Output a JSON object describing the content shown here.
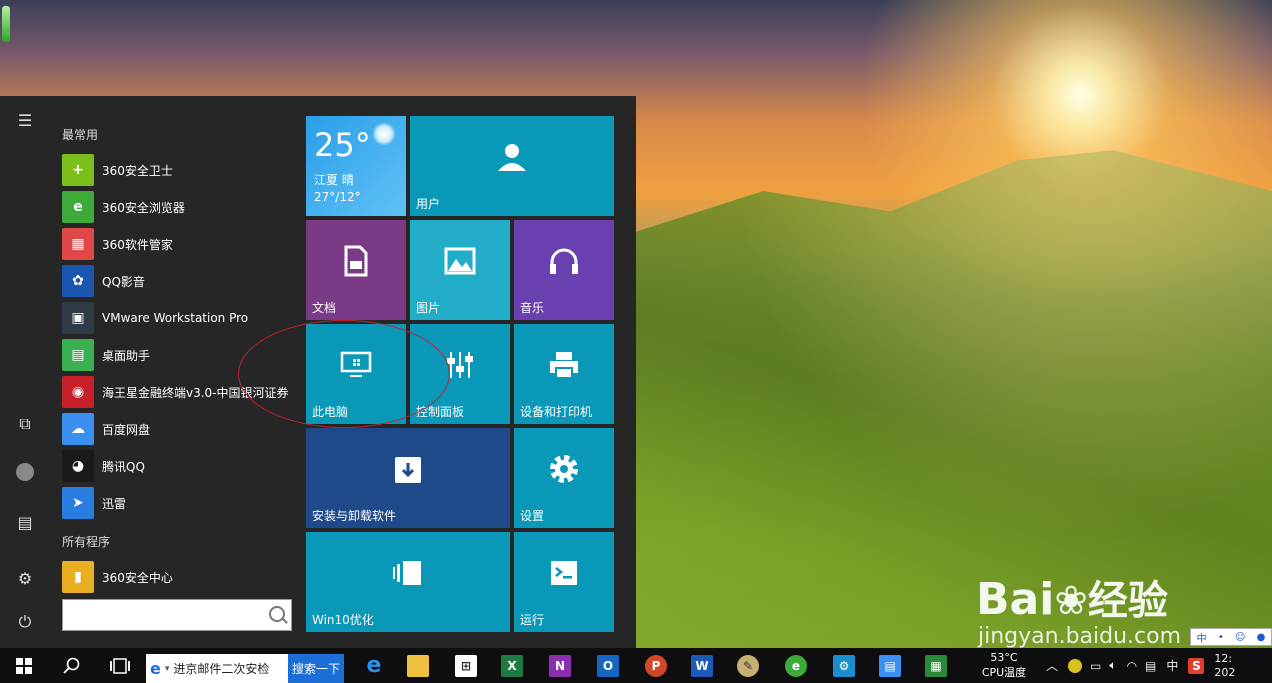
{
  "start_menu": {
    "most_used_label": "最常用",
    "all_programs_label": "所有程序",
    "apps": [
      {
        "label": "360安全卫士",
        "icon": "360-safe-icon",
        "color": "#7cbf1c",
        "glyph": "+"
      },
      {
        "label": "360安全浏览器",
        "icon": "360-browser-icon",
        "color": "#3eaa3a",
        "glyph": "e"
      },
      {
        "label": "360软件管家",
        "icon": "360-software-manager-icon",
        "color": "#e04848",
        "glyph": "▦"
      },
      {
        "label": "QQ影音",
        "icon": "qq-player-icon",
        "color": "#1a56b0",
        "glyph": "✿"
      },
      {
        "label": "VMware Workstation Pro",
        "icon": "vmware-icon",
        "color": "#2f3a44",
        "glyph": "▣"
      },
      {
        "label": "桌面助手",
        "icon": "desktop-assistant-icon",
        "color": "#3ab050",
        "glyph": "▤"
      },
      {
        "label": "海王星金融终端v3.0-中国银河证券",
        "icon": "neptune-finance-icon",
        "color": "#c8202a",
        "glyph": "◉"
      },
      {
        "label": "百度网盘",
        "icon": "baidu-netdisk-icon",
        "color": "#3a8ff0",
        "glyph": "☁"
      },
      {
        "label": "腾讯QQ",
        "icon": "tencent-qq-icon",
        "color": "#1a1a1a",
        "glyph": "◕"
      },
      {
        "label": "迅雷",
        "icon": "xunlei-icon",
        "color": "#2a7de0",
        "glyph": "➤"
      }
    ],
    "all_apps": [
      {
        "label": "360安全中心",
        "icon": "360-security-center-icon",
        "color": "#e8b020",
        "glyph": "▮"
      }
    ]
  },
  "tiles": {
    "weather": {
      "temp": "25°",
      "city": "江夏 晴",
      "range": "27°/12°"
    },
    "user": {
      "label": "用户"
    },
    "documents": {
      "label": "文档"
    },
    "pictures": {
      "label": "图片"
    },
    "music": {
      "label": "音乐"
    },
    "this_pc": {
      "label": "此电脑"
    },
    "control_panel": {
      "label": "控制面板"
    },
    "devices_printers": {
      "label": "设备和打印机"
    },
    "install_uninstall": {
      "label": "安装与卸载软件"
    },
    "settings": {
      "label": "设置"
    },
    "win10_optimize": {
      "label": "Win10优化"
    },
    "run": {
      "label": "运行"
    }
  },
  "taskbar": {
    "ie_field_text": "进京邮件二次安检",
    "ie_search_button": "搜索一下",
    "cpu_temp": "53°C",
    "cpu_label": "CPU温度",
    "ime": "中",
    "clock_time": "12:",
    "clock_date": "202"
  },
  "watermark": {
    "brand": "Bai",
    "brand2": "经验",
    "url": "jingyan.baidu.com"
  },
  "colors": {
    "tile_blue": "#0a98b8",
    "tile_purple": "#7b3a86",
    "tile_teal": "#21adc8",
    "tile_violet": "#6a3fb0",
    "tile_navy": "#1f4a8a",
    "start_bg": "#262626",
    "annotation_red": "#c8202a"
  }
}
